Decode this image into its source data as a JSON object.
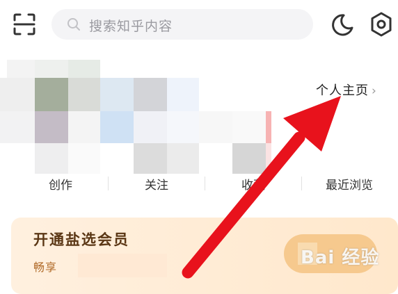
{
  "search": {
    "placeholder": "搜索知乎内容"
  },
  "icons": {
    "scan": "scan-icon",
    "search": "search-icon",
    "night_mode": "moon-icon",
    "settings": "gear-icon",
    "profile_chevron": "chevron-right-icon"
  },
  "profile": {
    "link_label": "个人主页"
  },
  "stats": [
    {
      "label": "创作"
    },
    {
      "label": "关注"
    },
    {
      "label": "收藏"
    },
    {
      "label": "最近浏览"
    }
  ],
  "vip_card": {
    "title": "开通盐选会员",
    "subtitle": "畅享"
  },
  "watermark": {
    "text": "Bai 经验"
  },
  "colors": {
    "annotation_arrow": "#e8121c",
    "vip_bg": "#ffecd6",
    "vip_title": "#5a3614",
    "vip_subtitle": "#b06a28"
  }
}
